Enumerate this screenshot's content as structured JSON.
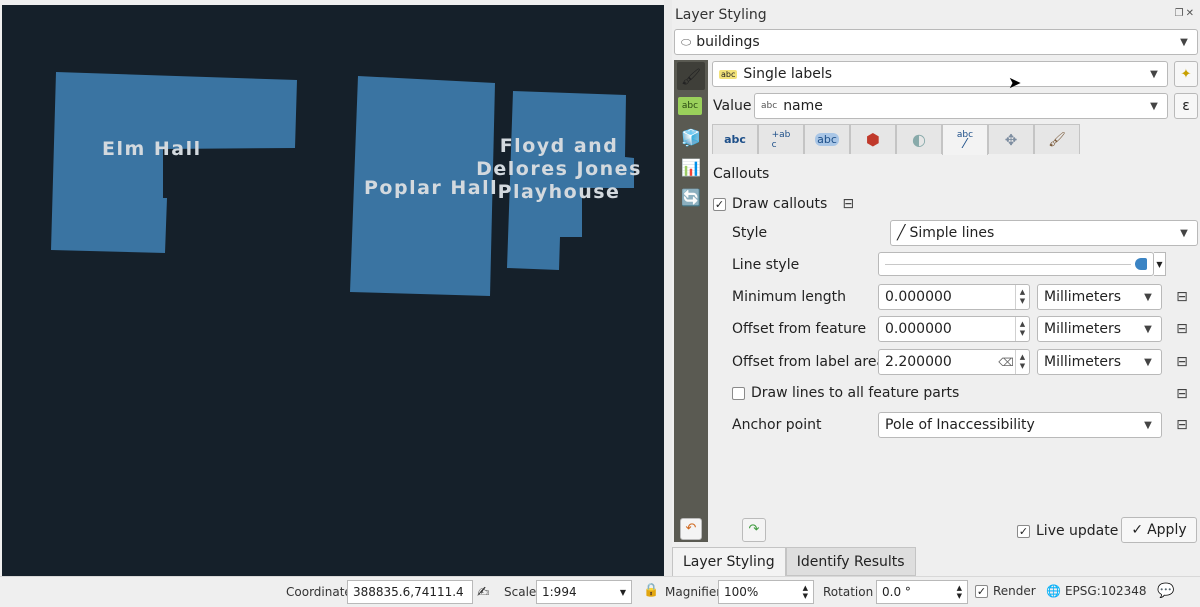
{
  "map": {
    "labels": {
      "elm": "Elm Hall",
      "poplar": "Poplar Hall",
      "floyd_line1": "Floyd and",
      "floyd_line2": "Delores Jones",
      "floyd_line3": "Playhouse"
    },
    "colors": {
      "background": "#15202a",
      "building": "#3a74a2",
      "label": "#d3d9de"
    }
  },
  "panel": {
    "title": "Layer Styling",
    "layer_combo": "buildings",
    "renderer_combo": "Single labels",
    "value_label": "Value",
    "value_field": "name",
    "value_prefix": "abc",
    "section": "Callouts",
    "draw_callouts_label": "Draw callouts",
    "draw_callouts_checked": true,
    "style_label": "Style",
    "style_value": "Simple lines",
    "line_style_label": "Line style",
    "min_length_label": "Minimum length",
    "min_length_value": "0.000000",
    "min_length_unit": "Millimeters",
    "offset_feature_label": "Offset from feature",
    "offset_feature_value": "0.000000",
    "offset_feature_unit": "Millimeters",
    "offset_label_label": "Offset from label area",
    "offset_label_value": "2.200000",
    "offset_label_unit": "Millimeters",
    "draw_all_parts_label": "Draw lines to all feature parts",
    "draw_all_parts_checked": false,
    "anchor_label": "Anchor point",
    "anchor_value": "Pole of Inaccessibility",
    "live_update_label": "Live update",
    "live_update_checked": true,
    "apply_label": "Apply",
    "tabs": [
      "abc",
      "+ab c",
      "abc",
      "shield",
      "shadow",
      "abc callout",
      "placement",
      "rendering"
    ],
    "bottom_tabs": [
      "Layer Styling",
      "Identify Results"
    ]
  },
  "status": {
    "coordinate_label": "Coordinate",
    "coordinate_value": "388835.6,74111.4",
    "scale_label": "Scale",
    "scale_value": "1:994",
    "magnifier_label": "Magnifier",
    "magnifier_value": "100%",
    "rotation_label": "Rotation",
    "rotation_value": "0.0 °",
    "render_label": "Render",
    "render_checked": true,
    "crs_value": "EPSG:102348"
  }
}
